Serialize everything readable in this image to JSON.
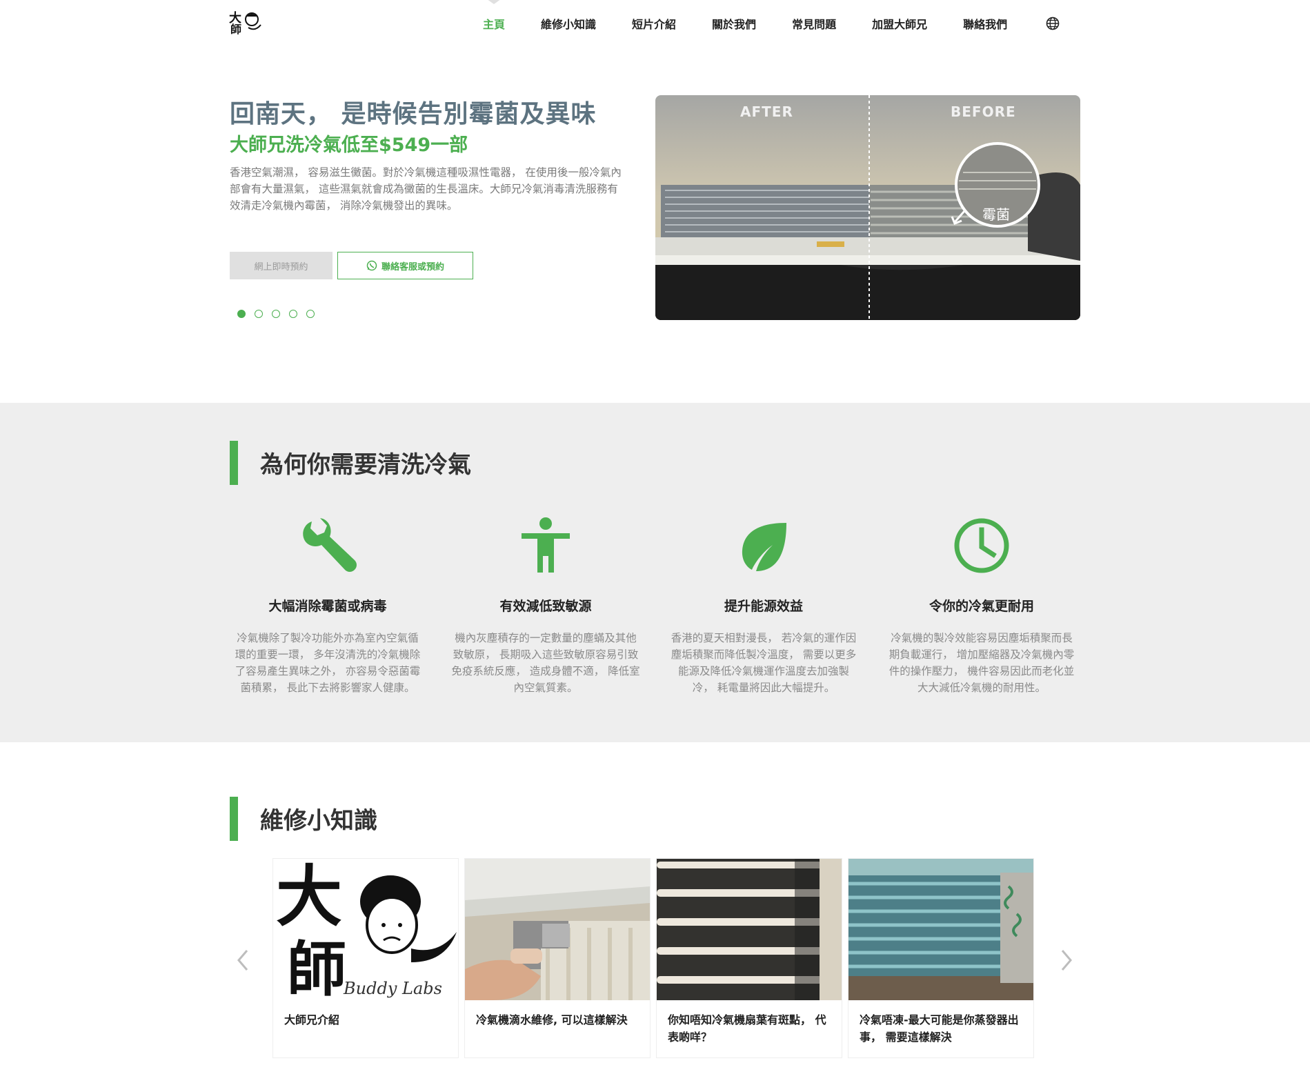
{
  "header": {
    "logo_alt": "大師兄 Buddy Labs",
    "nav": [
      {
        "label": "主頁",
        "active": true
      },
      {
        "label": "維修小知識",
        "active": false
      },
      {
        "label": "短片介紹",
        "active": false
      },
      {
        "label": "關於我們",
        "active": false
      },
      {
        "label": "常見問題",
        "active": false
      },
      {
        "label": "加盟大師兄",
        "active": false
      },
      {
        "label": "聯絡我們",
        "active": false
      }
    ],
    "language_icon": "globe-icon"
  },
  "hero": {
    "title": "回南天， 是時候告別霉菌及異味",
    "subtitle": "大師兄洗冷氣低至$549一部",
    "description": "香港空氣潮濕， 容易滋生黴菌。對於冷氣機這種吸濕性電器， 在使用後一般冷氣內部會有大量濕氣， 這些濕氣就會成為黴菌的生長溫床。大師兄冷氣消毒清洗服務有效清走冷氣機內霉菌， 消除冷氣機發出的異味。",
    "book_button": "網上即時預約",
    "contact_button": "聯絡客服或預約",
    "slide_count": 5,
    "active_slide": 1,
    "image_labels": {
      "after": "AFTER",
      "before": "BEFORE",
      "mold": "霉菌"
    }
  },
  "why": {
    "title": "為何你需要清洗冷氣",
    "features": [
      {
        "icon": "wrench-icon",
        "title": "大幅消除霉菌或病毒",
        "desc": "冷氣機除了製冷功能外亦為室內空氣循環的重要一環， 多年沒清洗的冷氣機除了容易產生異味之外， 亦容易令惡菌霉菌積累， 長此下去將影響家人健康。"
      },
      {
        "icon": "person-icon",
        "title": "有效減低致敏源",
        "desc": "機內灰塵積存的一定數量的塵蟎及其他致敏原， 長期吸入這些致敏原容易引致免疫系統反應， 造成身體不適， 降低室內空氣質素。"
      },
      {
        "icon": "leaf-icon",
        "title": "提升能源效益",
        "desc": "香港的夏天相對漫長， 若冷氣的運作因塵垢積聚而降低製冷溫度， 需要以更多能源及降低冷氣機運作溫度去加強製冷， 耗電量將因此大幅提升。"
      },
      {
        "icon": "clock-icon",
        "title": "令你的冷氣更耐用",
        "desc": "冷氣機的製冷效能容易因塵垢積聚而長期負載運行， 增加壓縮器及冷氣機內零件的操作壓力， 機件容易因此而老化並大大減低冷氣機的耐用性。"
      }
    ]
  },
  "knowledge": {
    "title": "維修小知識",
    "cards": [
      {
        "title": "大師兄介紹",
        "logo_text": "Buddy Labs"
      },
      {
        "title": "冷氣機滴水維修, 可以這樣解決"
      },
      {
        "title": "你知唔知冷氣機扇葉有斑點， 代表啲咩？"
      },
      {
        "title": "冷氣唔凍-最大可能是你蒸發器出事， 需要這樣解決"
      }
    ]
  },
  "colors": {
    "accent": "#4caf50",
    "title_gray": "#5d7380",
    "section_bg": "#eeeeee"
  }
}
